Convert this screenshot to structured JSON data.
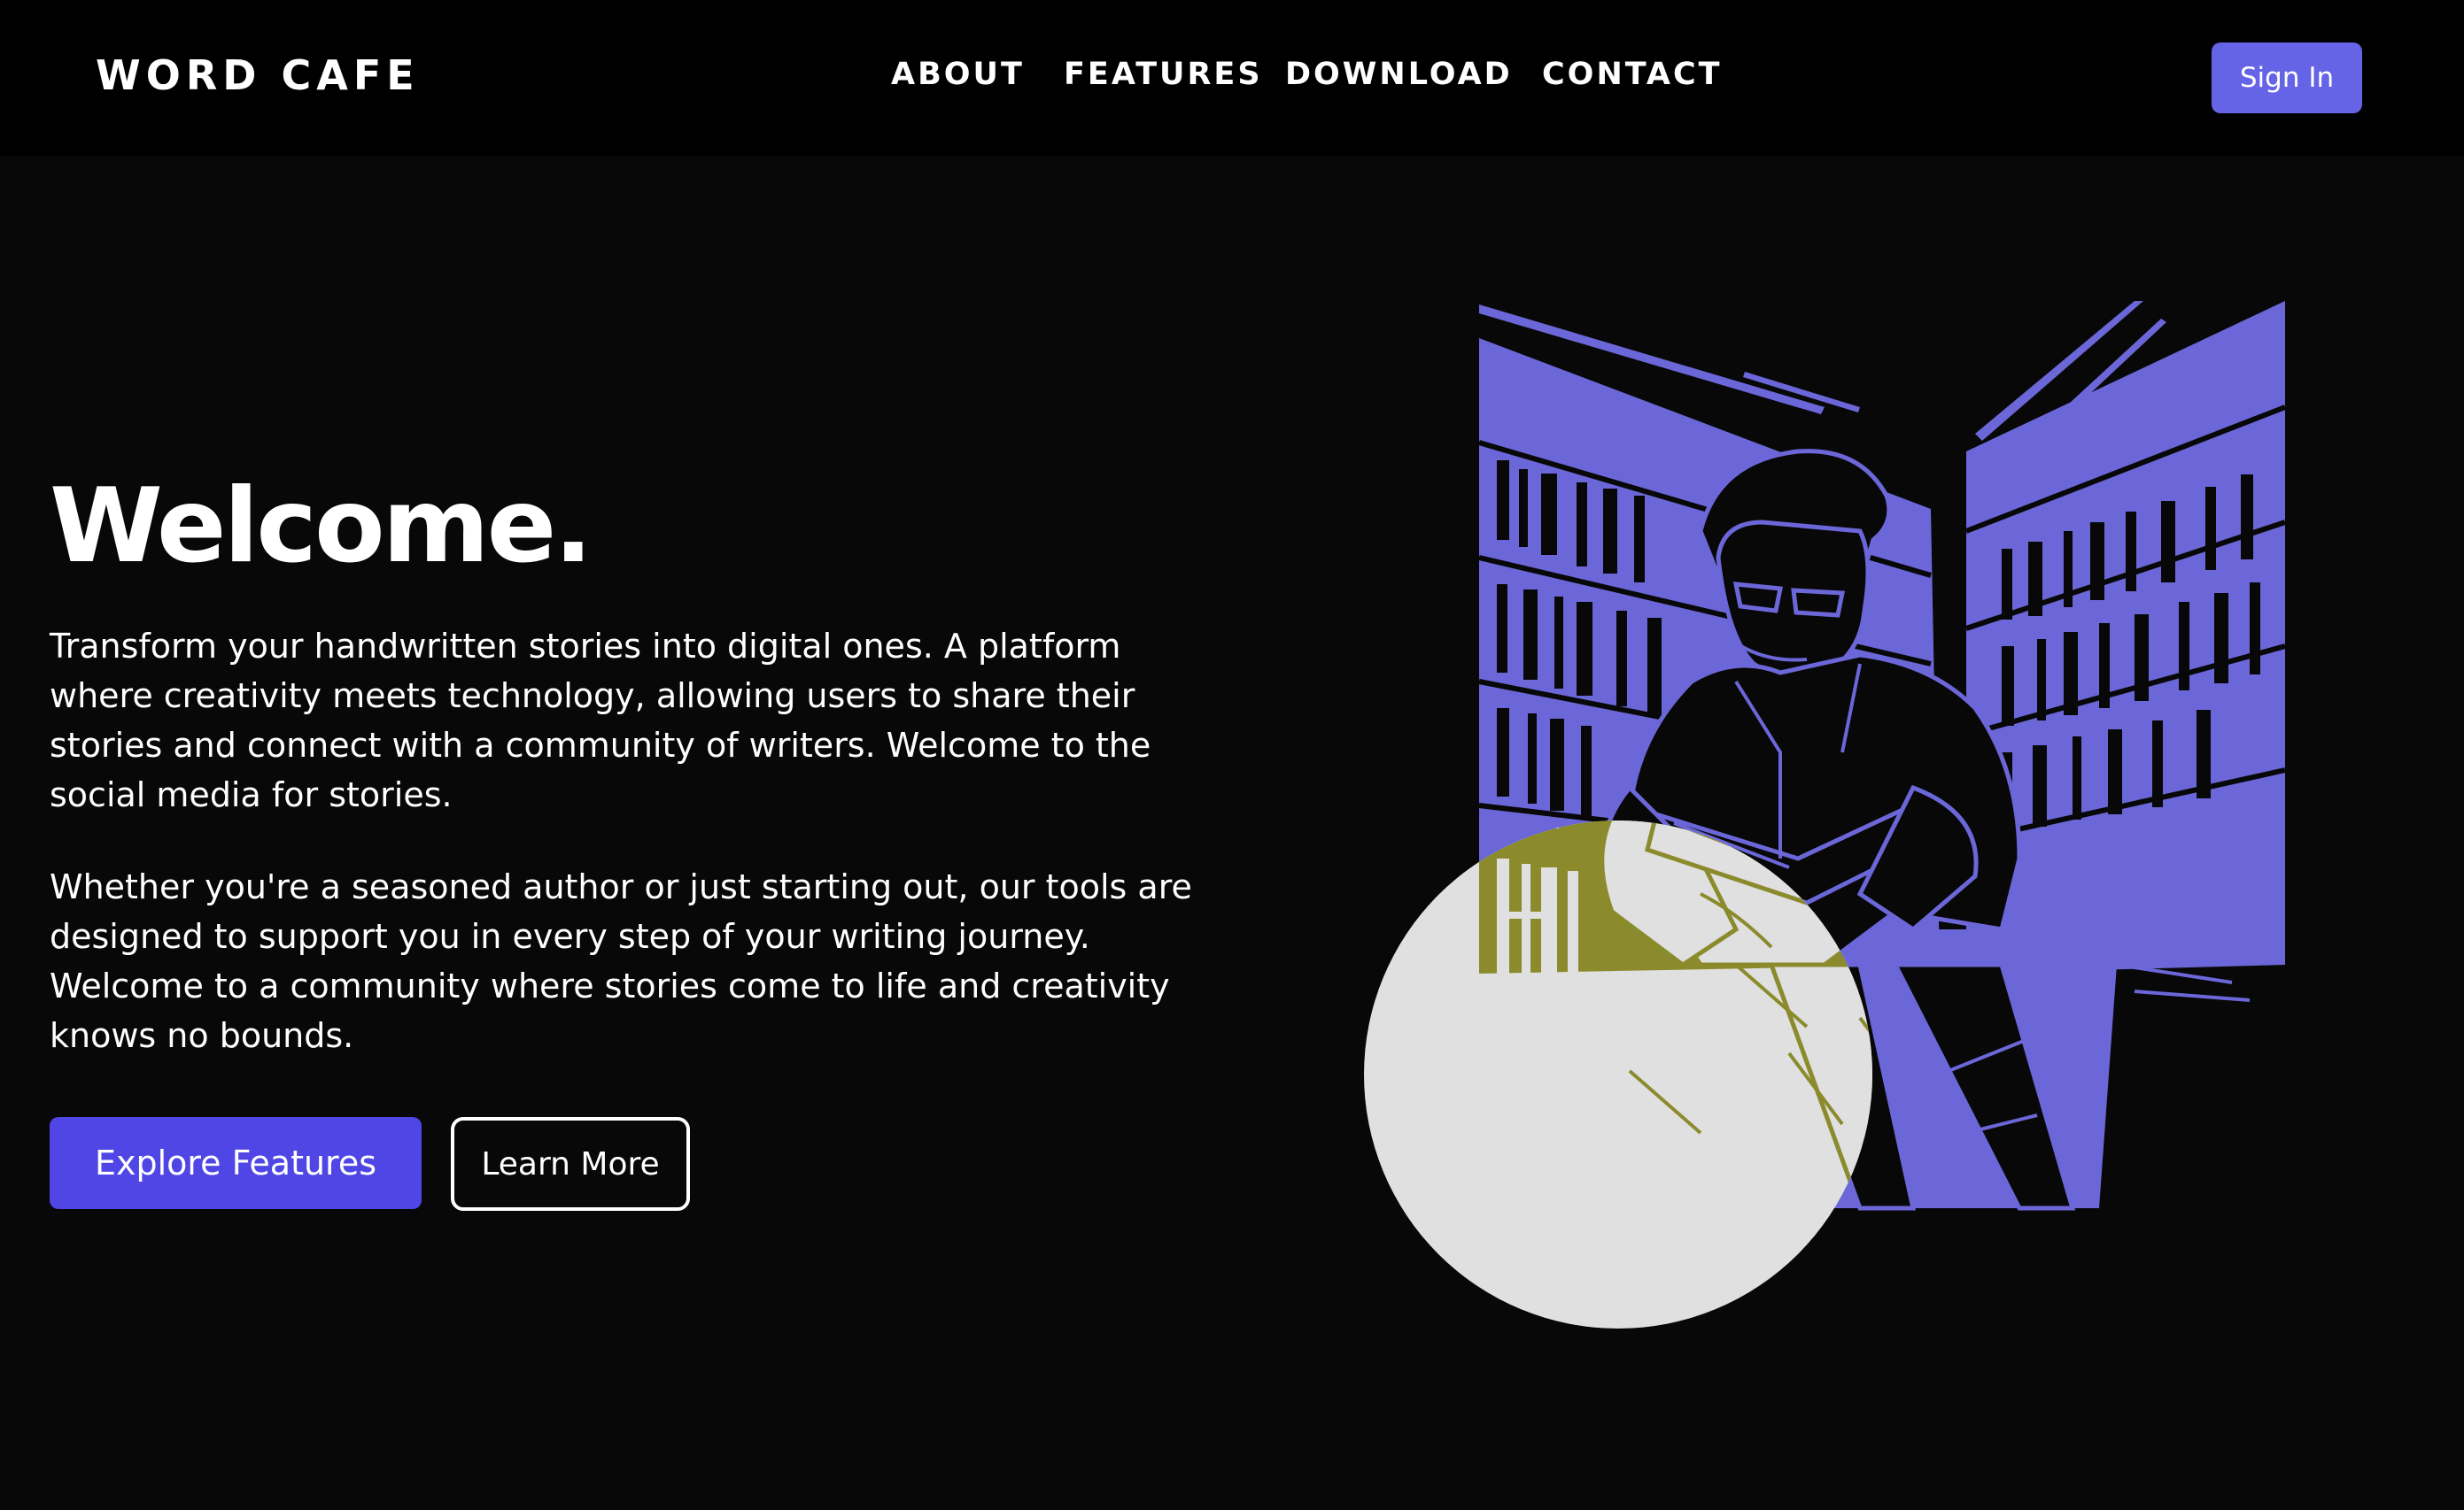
{
  "nav": {
    "brand": "WORD CAFE",
    "links": [
      "ABOUT",
      "FEATURES",
      "DOWNLOAD",
      "CONTACT"
    ],
    "signin_label": "Sign In"
  },
  "hero": {
    "title": "Welcome.",
    "paragraph1": "Transform your handwritten stories into digital ones. A platform where creativity meets technology, allowing users to share their stories and connect with a community of writers. Welcome to the social media for stories.",
    "paragraph2": "Whether you're a seasoned author or just starting out, our tools are designed to support you in every step of your writing journey. Welcome to a community where stories come to life and creativity knows no bounds.",
    "primary_button": "Explore Features",
    "secondary_button": "Learn More"
  },
  "colors": {
    "accent": "#4f46e5",
    "signin": "#6563e6",
    "illustration_purple": "#6b67d8",
    "illustration_olive": "#8b8b2e",
    "circle": "#e0e0e0",
    "background": "#080808",
    "navbar": "#000000"
  },
  "illustration": {
    "subject": "man-reading-book-in-library-illustration"
  }
}
